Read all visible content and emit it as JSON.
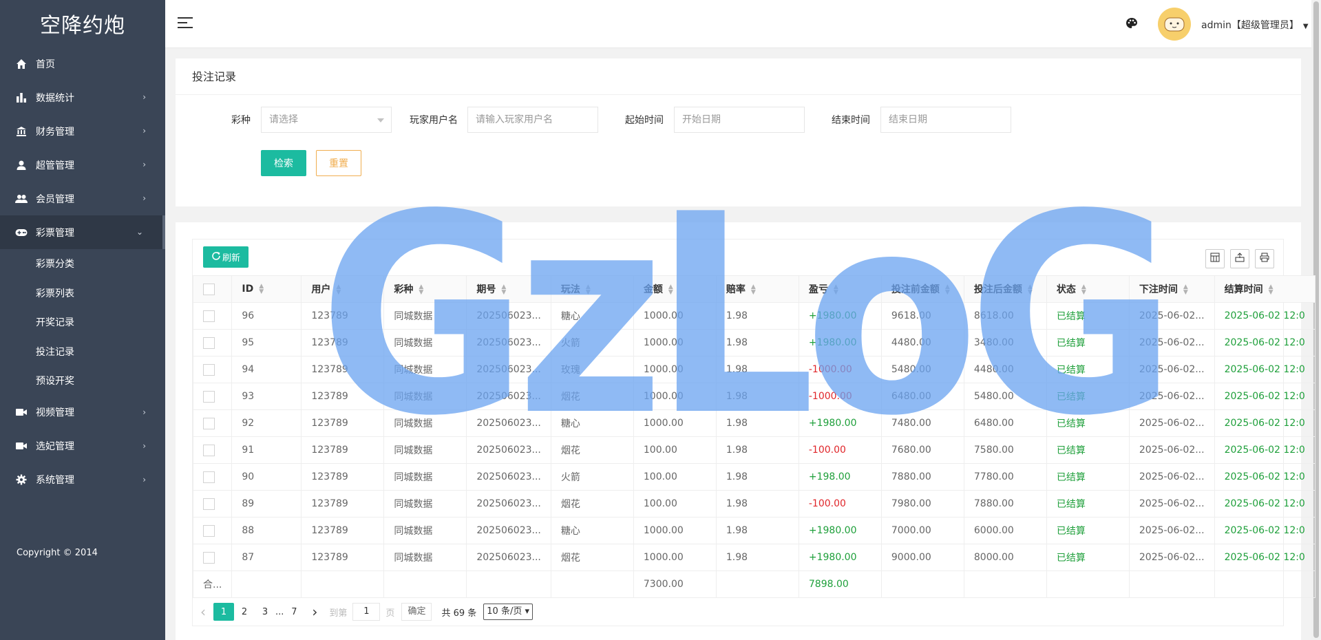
{
  "sidebar": {
    "brand": "空降约炮",
    "items": [
      {
        "label": "首页",
        "icon": "home-icon"
      },
      {
        "label": "数据统计",
        "icon": "bar-chart-icon"
      },
      {
        "label": "财务管理",
        "icon": "bank-icon"
      },
      {
        "label": "超管管理",
        "icon": "user-icon"
      },
      {
        "label": "会员管理",
        "icon": "users-icon"
      },
      {
        "label": "彩票管理",
        "icon": "gamepad-icon"
      },
      {
        "label": "视频管理",
        "icon": "video-icon"
      },
      {
        "label": "选妃管理",
        "icon": "video-icon"
      },
      {
        "label": "系统管理",
        "icon": "gear-icon"
      }
    ],
    "lottery_sub": [
      "彩票分类",
      "彩票列表",
      "开奖记录",
      "投注记录",
      "预设开奖"
    ],
    "copyright": "Copyright © 2014"
  },
  "header": {
    "user": "admin【超级管理员】"
  },
  "search": {
    "title": "投注记录",
    "lottery_label": "彩种",
    "lottery_placeholder": "请选择",
    "player_label": "玩家用户名",
    "player_placeholder": "请输入玩家用户名",
    "start_label": "起始时间",
    "start_placeholder": "开始日期",
    "end_label": "结束时间",
    "end_placeholder": "结束日期",
    "search_btn": "检索",
    "reset_btn": "重置"
  },
  "toolbar": {
    "refresh": "刷新"
  },
  "table": {
    "headers": [
      "ID",
      "用户",
      "彩种",
      "期号",
      "玩法",
      "金额",
      "赔率",
      "盈亏",
      "投注前金额",
      "投注后金额",
      "状态",
      "下注时间",
      "结算时间"
    ],
    "rows": [
      {
        "id": "96",
        "user": "123789",
        "lottery": "同城数据",
        "period": "202506023...",
        "play": "糖心",
        "amount": "1000.00",
        "odds": "1.98",
        "pl": "+1980.00",
        "before": "9618.00",
        "after": "8618.00",
        "status": "已结算",
        "bet_time": "2025-06-02...",
        "settle_time": "2025-06-02 12:0"
      },
      {
        "id": "95",
        "user": "123789",
        "lottery": "同城数据",
        "period": "202506023...",
        "play": "火箭",
        "amount": "1000.00",
        "odds": "1.98",
        "pl": "+1980.00",
        "before": "4480.00",
        "after": "3480.00",
        "status": "已结算",
        "bet_time": "2025-06-02...",
        "settle_time": "2025-06-02 12:0"
      },
      {
        "id": "94",
        "user": "123789",
        "lottery": "同城数据",
        "period": "202506023...",
        "play": "玫瑰",
        "amount": "1000.00",
        "odds": "1.98",
        "pl": "-1000.00",
        "before": "5480.00",
        "after": "4480.00",
        "status": "已结算",
        "bet_time": "2025-06-02...",
        "settle_time": "2025-06-02 12:0"
      },
      {
        "id": "93",
        "user": "123789",
        "lottery": "同城数据",
        "period": "202506023...",
        "play": "烟花",
        "amount": "1000.00",
        "odds": "1.98",
        "pl": "-1000.00",
        "before": "6480.00",
        "after": "5480.00",
        "status": "已结算",
        "bet_time": "2025-06-02...",
        "settle_time": "2025-06-02 12:0"
      },
      {
        "id": "92",
        "user": "123789",
        "lottery": "同城数据",
        "period": "202506023...",
        "play": "糖心",
        "amount": "1000.00",
        "odds": "1.98",
        "pl": "+1980.00",
        "before": "7480.00",
        "after": "6480.00",
        "status": "已结算",
        "bet_time": "2025-06-02...",
        "settle_time": "2025-06-02 12:0"
      },
      {
        "id": "91",
        "user": "123789",
        "lottery": "同城数据",
        "period": "202506023...",
        "play": "烟花",
        "amount": "100.00",
        "odds": "1.98",
        "pl": "-100.00",
        "before": "7680.00",
        "after": "7580.00",
        "status": "已结算",
        "bet_time": "2025-06-02...",
        "settle_time": "2025-06-02 12:0"
      },
      {
        "id": "90",
        "user": "123789",
        "lottery": "同城数据",
        "period": "202506023...",
        "play": "火箭",
        "amount": "100.00",
        "odds": "1.98",
        "pl": "+198.00",
        "before": "7880.00",
        "after": "7780.00",
        "status": "已结算",
        "bet_time": "2025-06-02...",
        "settle_time": "2025-06-02 12:0"
      },
      {
        "id": "89",
        "user": "123789",
        "lottery": "同城数据",
        "period": "202506023...",
        "play": "烟花",
        "amount": "100.00",
        "odds": "1.98",
        "pl": "-100.00",
        "before": "7980.00",
        "after": "7880.00",
        "status": "已结算",
        "bet_time": "2025-06-02...",
        "settle_time": "2025-06-02 12:0"
      },
      {
        "id": "88",
        "user": "123789",
        "lottery": "同城数据",
        "period": "202506023...",
        "play": "糖心",
        "amount": "1000.00",
        "odds": "1.98",
        "pl": "+1980.00",
        "before": "7000.00",
        "after": "6000.00",
        "status": "已结算",
        "bet_time": "2025-06-02...",
        "settle_time": "2025-06-02 12:0"
      },
      {
        "id": "87",
        "user": "123789",
        "lottery": "同城数据",
        "period": "202506023...",
        "play": "烟花",
        "amount": "1000.00",
        "odds": "1.98",
        "pl": "+1980.00",
        "before": "9000.00",
        "after": "8000.00",
        "status": "已结算",
        "bet_time": "2025-06-02...",
        "settle_time": "2025-06-02 12:0"
      }
    ],
    "total_label": "合...",
    "total_amount": "7300.00",
    "total_pl": "7898.00"
  },
  "pager": {
    "prev": "‹",
    "pages": [
      "1",
      "2",
      "3"
    ],
    "ellipsis": "...",
    "last": "7",
    "next": "›",
    "goto_label": "到第",
    "goto_value": "1",
    "page_unit": "页",
    "confirm": "确定",
    "total": "共 69 条",
    "size": "10 条/页"
  },
  "watermark": {
    "text": "GzLoG",
    "color": "#6aa3f0"
  },
  "colors": {
    "sidebar_bg": "#3a4556",
    "accent": "#1cbba0",
    "positive": "#1e9f3a",
    "negative": "#e0262a",
    "reset": "#f0ad4e"
  }
}
